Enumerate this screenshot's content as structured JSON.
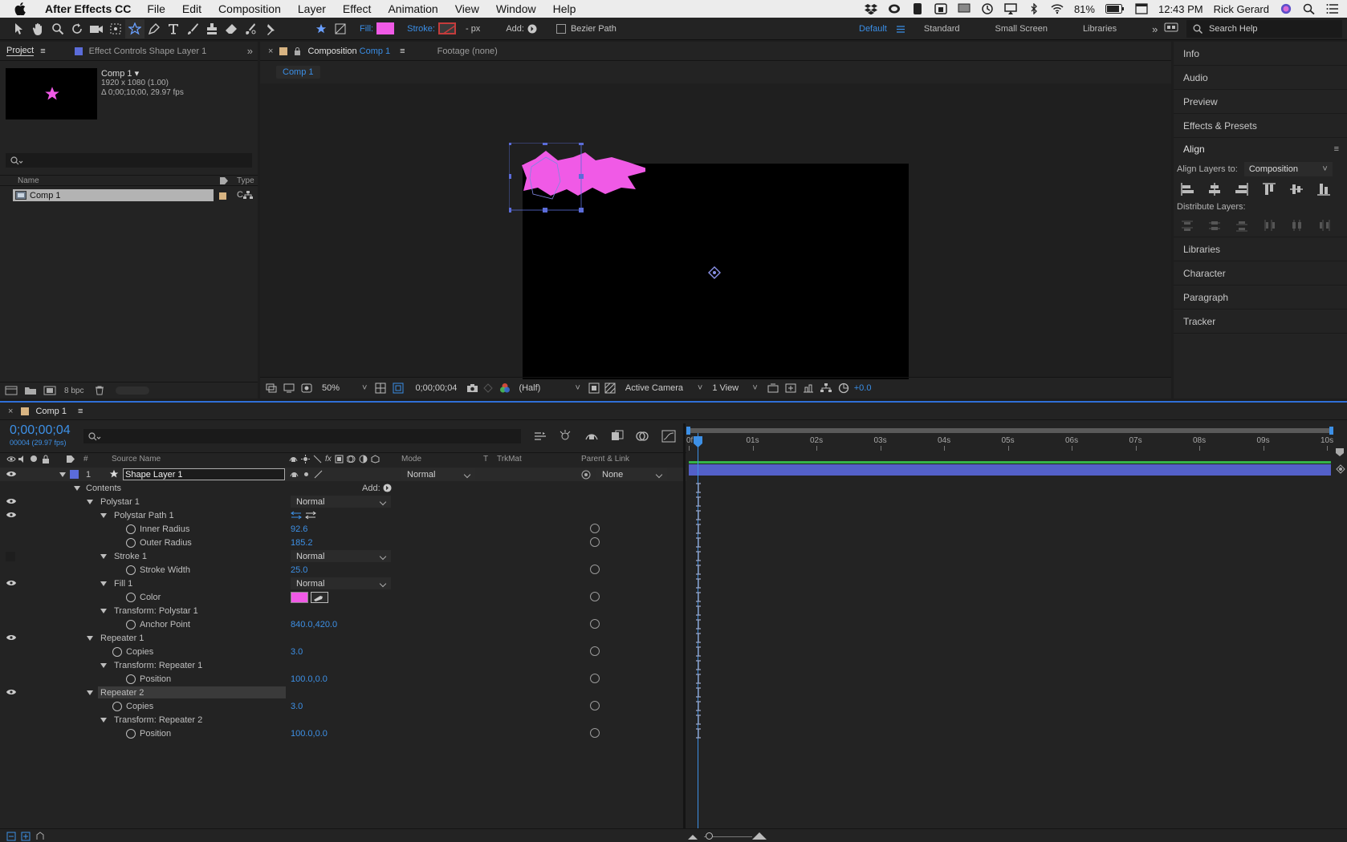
{
  "menubar": {
    "app_name": "After Effects CC",
    "menus": [
      "File",
      "Edit",
      "Composition",
      "Layer",
      "Effect",
      "Animation",
      "View",
      "Window",
      "Help"
    ],
    "battery": "81%",
    "clock": "12:43 PM",
    "user": "Rick Gerard"
  },
  "toolbar": {
    "fill_label": "Fill:",
    "stroke_label": "Stroke:",
    "stroke_px": "- px",
    "add_label": "Add:",
    "bezier_label": "Bezier Path",
    "fill_color": "#f05ae6",
    "workspaces": [
      "Default",
      "Standard",
      "Small Screen",
      "Libraries"
    ],
    "search_placeholder": "Search Help"
  },
  "project": {
    "tab_project": "Project",
    "tab_effects": "Effect Controls Shape Layer 1",
    "comp_name": "Comp 1 ▾",
    "comp_size": "1920 x 1080 (1.00)",
    "comp_duration": "Δ 0;00;10;00, 29.97 fps",
    "col_name": "Name",
    "col_type": "Type",
    "item_name": "Comp 1",
    "item_type": "C",
    "bpc": "8 bpc"
  },
  "composition": {
    "tab_label": "Composition",
    "tab_comp": "Comp 1",
    "footage_tab": "Footage (none)",
    "breadcrumb": "Comp 1",
    "zoom": "50%",
    "timecode": "0;00;00;04",
    "resolution": "(Half)",
    "camera": "Active Camera",
    "view": "1 View",
    "exposure": "+0.0",
    "star_color": "#f05ae6"
  },
  "right_panel": {
    "items_top": [
      "Info",
      "Audio",
      "Preview",
      "Effects & Presets"
    ],
    "align_title": "Align",
    "align_to_label": "Align Layers to:",
    "align_to_value": "Composition",
    "distribute_label": "Distribute Layers:",
    "items_bottom": [
      "Libraries",
      "Character",
      "Paragraph",
      "Tracker"
    ]
  },
  "timeline": {
    "tab": "Comp 1",
    "timecode": "0;00;00;04",
    "frame_info": "00004 (29.97 fps)",
    "col_source": "Source Name",
    "col_mode": "Mode",
    "col_t": "T",
    "col_trkmat": "TrkMat",
    "col_parent": "Parent & Link",
    "layer_num": "1",
    "layer_name": "Shape Layer 1",
    "layer_mode": "Normal",
    "layer_parent": "None",
    "contents_label": "Contents",
    "add_label": "Add:",
    "polystar1": "Polystar 1",
    "polystar1_mode": "Normal",
    "polystar_path": "Polystar Path 1",
    "inner_radius_label": "Inner Radius",
    "inner_radius": "92.6",
    "outer_radius_label": "Outer Radius",
    "outer_radius": "185.2",
    "stroke1": "Stroke 1",
    "stroke1_mode": "Normal",
    "stroke_width_label": "Stroke Width",
    "stroke_width": "25.0",
    "fill1": "Fill 1",
    "fill1_mode": "Normal",
    "color_label": "Color",
    "transform_poly": "Transform: Polystar 1",
    "anchor_label": "Anchor Point",
    "anchor": "840.0,420.0",
    "repeater1": "Repeater 1",
    "copies_label": "Copies",
    "copies1": "3.0",
    "transform_rep1": "Transform: Repeater 1",
    "position_label": "Position",
    "position1": "100.0,0.0",
    "repeater2": "Repeater 2",
    "copies2": "3.0",
    "transform_rep2": "Transform: Repeater 2",
    "position2": "100.0,0.0",
    "ruler": [
      "0f",
      "01s",
      "02s",
      "03s",
      "04s",
      "05s",
      "06s",
      "07s",
      "08s",
      "09s",
      "10s"
    ]
  }
}
